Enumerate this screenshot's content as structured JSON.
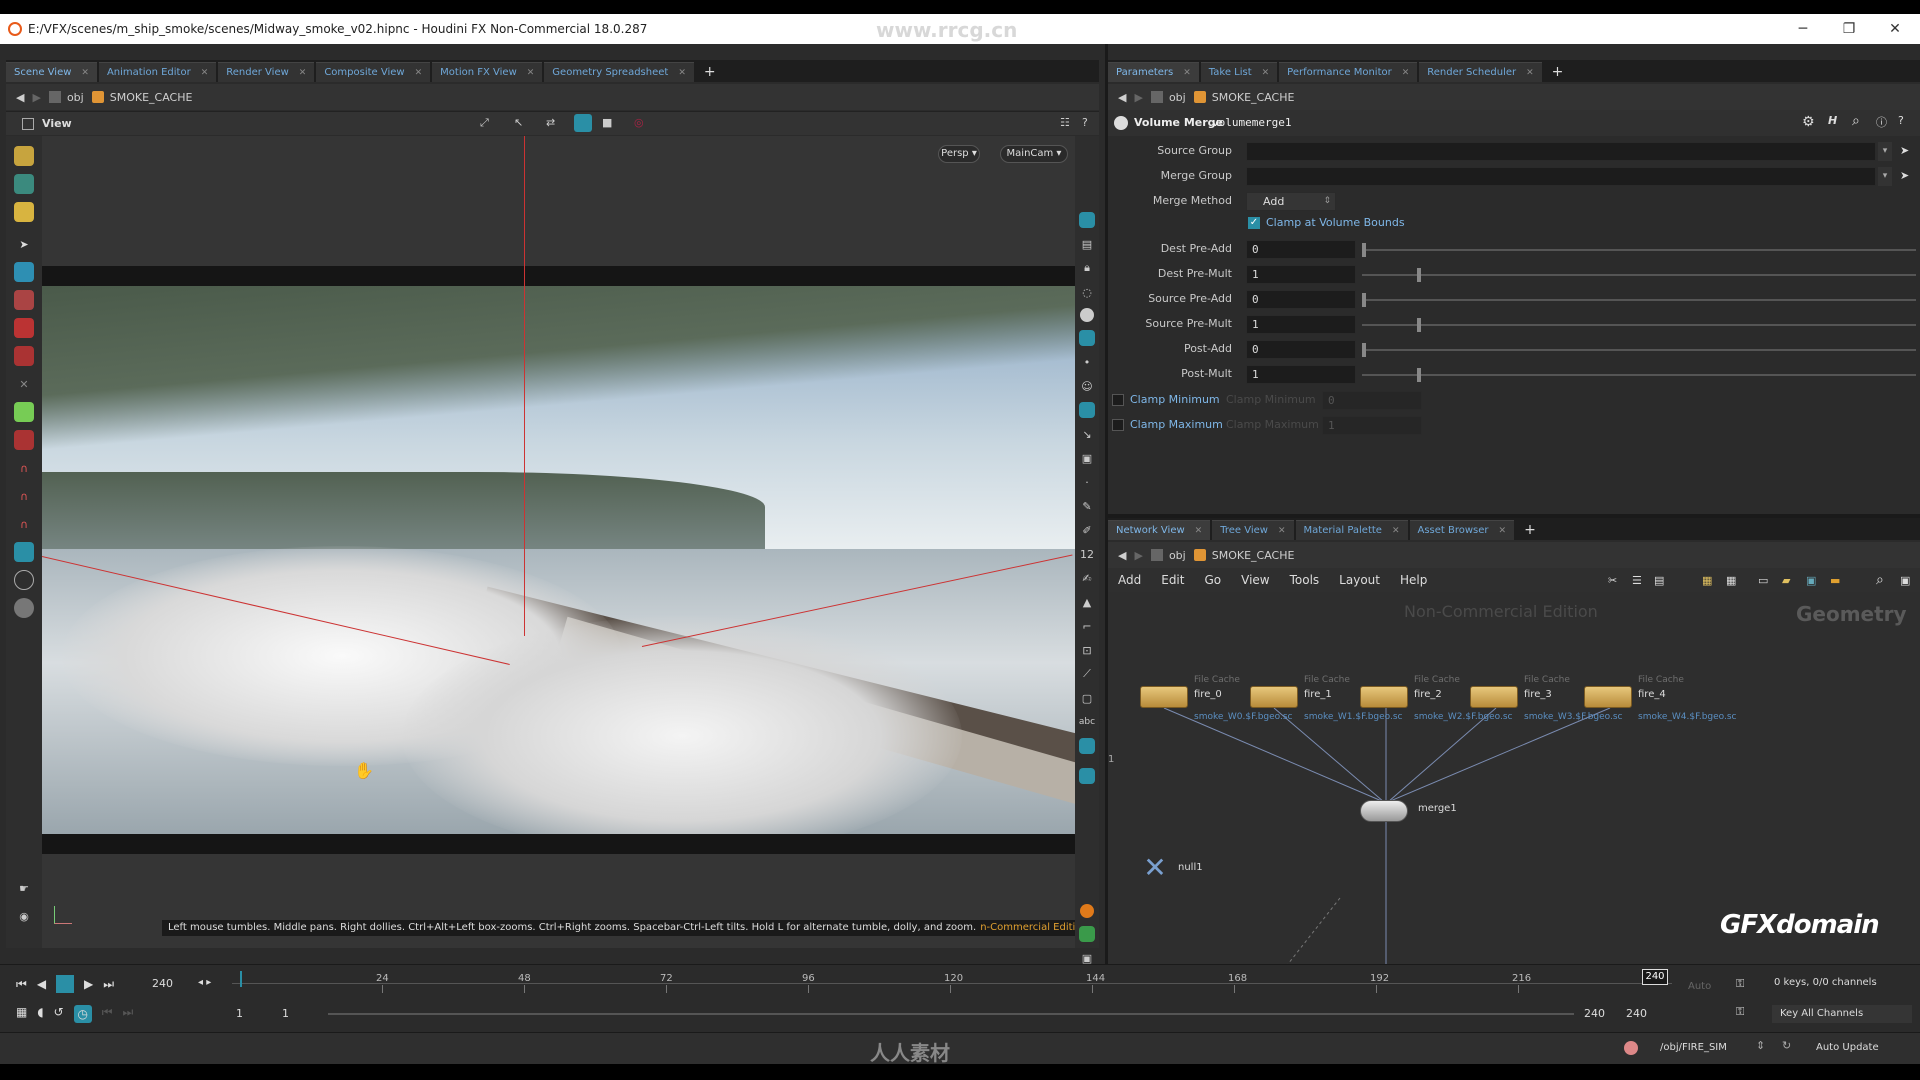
{
  "window": {
    "title": "E:/VFX/scenes/m_ship_smoke/scenes/Midway_smoke_v02.hipnc - Houdini FX Non-Commercial 18.0.287",
    "watermark_top": "www.rrcg.cn",
    "min": "─",
    "max": "❐",
    "close": "✕"
  },
  "left_pane": {
    "tabs": [
      {
        "label": "Scene View"
      },
      {
        "label": "Animation Editor"
      },
      {
        "label": "Render View"
      },
      {
        "label": "Composite View"
      },
      {
        "label": "Motion FX View"
      },
      {
        "label": "Geometry Spreadsheet"
      }
    ],
    "add_tab": "+",
    "path": {
      "root": "obj",
      "node": "SMOKE_CACHE"
    },
    "view_label": "View",
    "persp_btn": "Persp ▾",
    "cam_btn": "MainCam ▾",
    "status_text": "Left mouse tumbles. Middle pans. Right dollies. Ctrl+Alt+Left box-zooms. Ctrl+Right zooms. Spacebar-Ctrl-Left tilts. Hold L for alternate tumble, dolly, and zoom.",
    "edition_text": "n-Commercial Edition"
  },
  "param_pane": {
    "tabs": [
      {
        "label": "Parameters"
      },
      {
        "label": "Take List"
      },
      {
        "label": "Performance Monitor"
      },
      {
        "label": "Render Scheduler"
      }
    ],
    "add_tab": "+",
    "path": {
      "root": "obj",
      "node": "SMOKE_CACHE"
    },
    "node_type": "Volume Merge",
    "node_name": "volumemerge1",
    "source_group_label": "Source Group",
    "merge_group_label": "Merge Group",
    "merge_method_label": "Merge Method",
    "merge_method_value": "Add",
    "clamp_bounds_label": "Clamp at Volume Bounds",
    "clamp_bounds_checked": true,
    "sliders": [
      {
        "label": "Dest Pre-Add",
        "value": "0",
        "fraction": 0.0
      },
      {
        "label": "Dest Pre-Mult",
        "value": "1",
        "fraction": 0.1
      },
      {
        "label": "Source Pre-Add",
        "value": "0",
        "fraction": 0.0
      },
      {
        "label": "Source Pre-Mult",
        "value": "1",
        "fraction": 0.1
      },
      {
        "label": "Post-Add",
        "value": "0",
        "fraction": 0.0
      },
      {
        "label": "Post-Mult",
        "value": "1",
        "fraction": 0.1
      }
    ],
    "clamp_min": {
      "label": "Clamp Minimum",
      "ghost": "Clamp Minimum",
      "value": "0"
    },
    "clamp_max": {
      "label": "Clamp Maximum",
      "ghost": "Clamp Maximum",
      "value": "1"
    }
  },
  "network_pane": {
    "tabs": [
      {
        "label": "Network View"
      },
      {
        "label": "Tree View"
      },
      {
        "label": "Material Palette"
      },
      {
        "label": "Asset Browser"
      }
    ],
    "add_tab": "+",
    "path": {
      "root": "obj",
      "node": "SMOKE_CACHE"
    },
    "menu": [
      "Add",
      "Edit",
      "Go",
      "View",
      "Tools",
      "Layout",
      "Help"
    ],
    "edition_watermark": "Non-Commercial Edition",
    "context_label": "Geometry",
    "side_number": "1",
    "nodes": [
      {
        "type": "File Cache",
        "name": "fire_0",
        "file": "smoke_W0.$F.bgeo.sc"
      },
      {
        "type": "File Cache",
        "name": "fire_1",
        "file": "smoke_W1.$F.bgeo.sc"
      },
      {
        "type": "File Cache",
        "name": "fire_2",
        "file": "smoke_W2.$F.bgeo.sc"
      },
      {
        "type": "File Cache",
        "name": "fire_3",
        "file": "smoke_W3.$F.bgeo.sc"
      },
      {
        "type": "File Cache",
        "name": "fire_4",
        "file": "smoke_W4.$F.bgeo.sc"
      }
    ],
    "merge_node": "merge1",
    "null_node": "null1",
    "logo": "GFXdomain"
  },
  "timeline": {
    "current_frame": "240",
    "ticks": [
      "24",
      "48",
      "72",
      "96",
      "120",
      "144",
      "168",
      "192",
      "216"
    ],
    "end_marker": "240",
    "range_start": "1",
    "range_start2": "1",
    "range_end": "240",
    "range_end2": "240",
    "keys_text": "0 keys, 0/0 channels",
    "key_all": "Key All Channels",
    "auto_label": "Auto",
    "obj_path": "/obj/FIRE_SIM",
    "auto_update": "Auto Update"
  },
  "footer": {
    "watermark": "人人素材"
  }
}
